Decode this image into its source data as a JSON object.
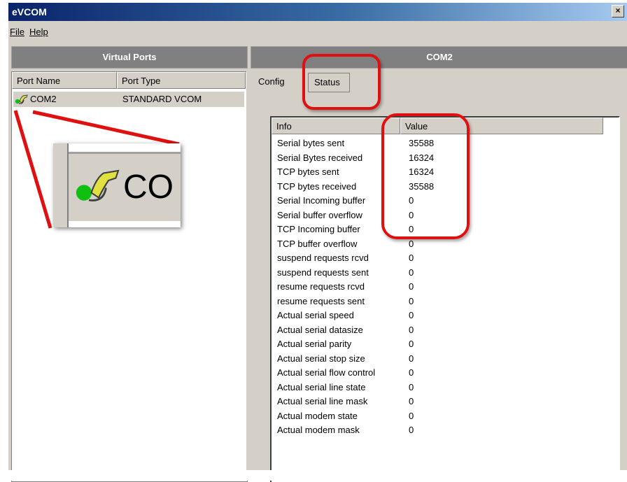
{
  "window": {
    "title": "eVCOM",
    "close_glyph": "×"
  },
  "menu": {
    "file": "File",
    "help": "Help"
  },
  "left_pane": {
    "header": "Virtual Ports",
    "columns": [
      "Port Name",
      "Port Type"
    ],
    "rows": [
      {
        "name": "COM2",
        "type": "STANDARD VCOM",
        "icon": "serial-port-icon"
      }
    ],
    "zoom_label": "CO"
  },
  "right_pane": {
    "header": "COM2",
    "tabs": {
      "config": "Config",
      "status": "Status"
    },
    "columns": [
      "Info",
      "Value"
    ],
    "stats": [
      {
        "info": "Serial bytes sent",
        "value": "35588"
      },
      {
        "info": "Serial Bytes received",
        "value": "16324"
      },
      {
        "info": "TCP bytes sent",
        "value": "16324"
      },
      {
        "info": "TCP bytes received",
        "value": "35588"
      },
      {
        "info": "Serial Incoming buffer",
        "value": "0"
      },
      {
        "info": "Serial buffer overflow",
        "value": "0"
      },
      {
        "info": "TCP Incoming buffer",
        "value": "0"
      },
      {
        "info": "TCP buffer overflow",
        "value": "0"
      },
      {
        "info": "suspend requests rcvd",
        "value": "0"
      },
      {
        "info": "suspend requests sent",
        "value": "0"
      },
      {
        "info": "resume requests rcvd",
        "value": "0"
      },
      {
        "info": "resume requests sent",
        "value": "0"
      },
      {
        "info": "Actual serial speed",
        "value": "0"
      },
      {
        "info": "Actual serial datasize",
        "value": "0"
      },
      {
        "info": "Actual serial parity",
        "value": "0"
      },
      {
        "info": "Actual serial stop size",
        "value": "0"
      },
      {
        "info": "Actual serial flow control",
        "value": "0"
      },
      {
        "info": "Actual serial line state",
        "value": "0"
      },
      {
        "info": "Actual serial line mask",
        "value": "0"
      },
      {
        "info": "Actual modem state",
        "value": "0"
      },
      {
        "info": "Actual  modem mask",
        "value": "0"
      }
    ]
  },
  "colors": {
    "callout": "#e01010",
    "titlebar_start": "#0a246a",
    "face": "#d4d0c8",
    "header": "#808080"
  }
}
